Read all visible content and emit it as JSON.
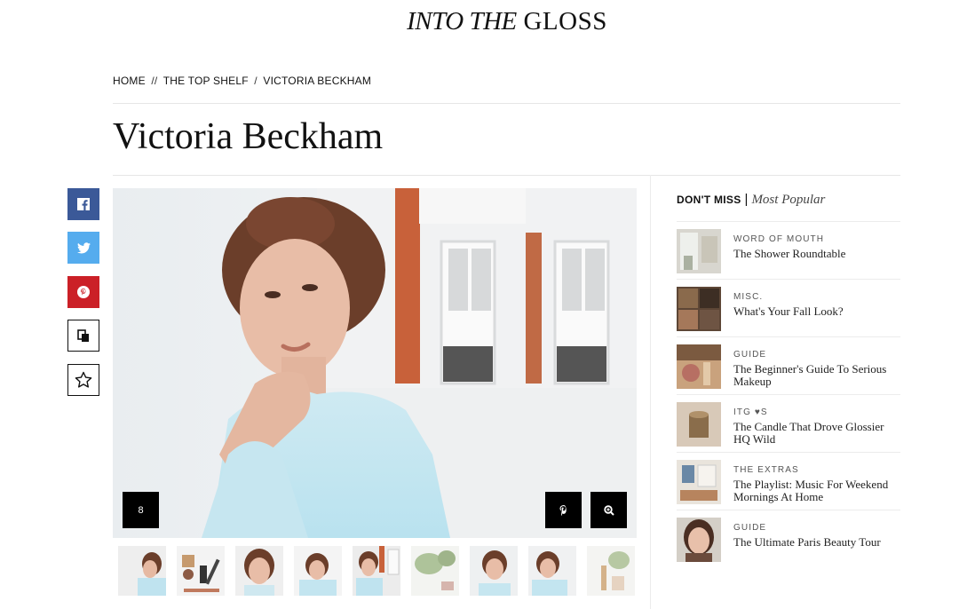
{
  "site": {
    "logo_italic": "INTO THE",
    "logo_regular": "GLOSS"
  },
  "breadcrumb": {
    "home": "HOME",
    "sep1": "//",
    "section": "THE TOP SHELF",
    "sep2": "/",
    "current": "VICTORIA BECKHAM"
  },
  "article": {
    "title": "Victoria Beckham"
  },
  "share": {
    "facebook": "facebook-icon",
    "twitter": "twitter-icon",
    "pinterest": "pinterest-icon",
    "copy": "copy-icon",
    "favorite": "star-icon"
  },
  "gallery": {
    "count": "8",
    "pin_icon": "pinterest-icon",
    "zoom_icon": "zoom-icon",
    "thumbnail_count": 9
  },
  "dont_miss": {
    "heading": "DON'T MISS",
    "divider": "|",
    "alt_tab": "Most Popular",
    "items": [
      {
        "category": "WORD OF MOUTH",
        "title": "The Shower Roundtable"
      },
      {
        "category": "MISC.",
        "title": "What's Your Fall Look?"
      },
      {
        "category": "GUIDE",
        "title": "The Beginner's Guide To Serious Makeup"
      },
      {
        "category": "ITG ♥S",
        "title": "The Candle That Drove Glossier HQ Wild"
      },
      {
        "category": "THE EXTRAS",
        "title": "The Playlist: Music For Weekend Mornings At Home"
      },
      {
        "category": "GUIDE",
        "title": "The Ultimate Paris Beauty Tour"
      }
    ]
  },
  "colors": {
    "facebook": "#3b5998",
    "twitter": "#55acee",
    "pinterest": "#cb2027"
  }
}
